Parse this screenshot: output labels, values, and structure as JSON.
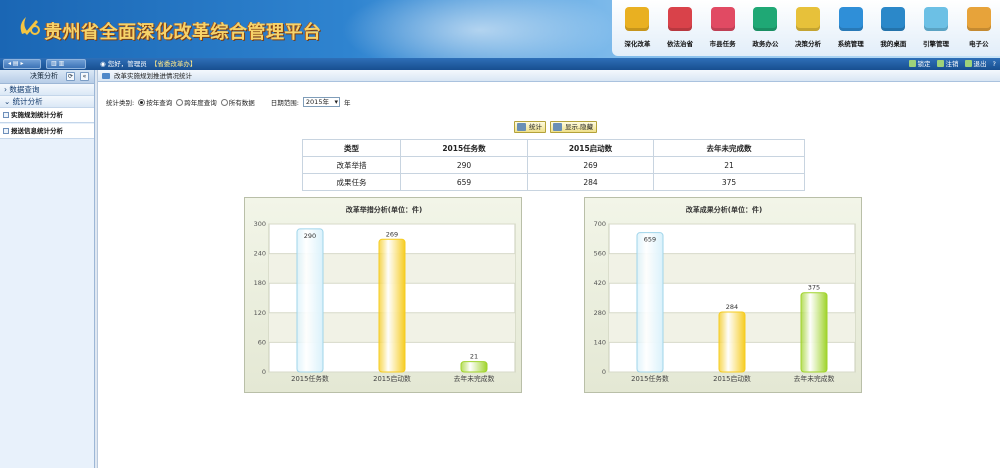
{
  "app": {
    "title": "贵州省全面深化改革综合管理平台"
  },
  "nav": [
    {
      "label": "深化改革",
      "icon": "reform-icon",
      "color": "#e9b021"
    },
    {
      "label": "依法治省",
      "icon": "law-icon",
      "color": "#d9424a"
    },
    {
      "label": "市县任务",
      "icon": "mail-icon",
      "color": "#e14a63"
    },
    {
      "label": "政务办公",
      "icon": "office-icon",
      "color": "#1fa875"
    },
    {
      "label": "决策分析",
      "icon": "analysis-icon",
      "color": "#e7c13a"
    },
    {
      "label": "系统管理",
      "icon": "tools-icon",
      "color": "#2f8fd8"
    },
    {
      "label": "我的桌面",
      "icon": "desktop-icon",
      "color": "#2b88c9"
    },
    {
      "label": "引擎管理",
      "icon": "engine-icon",
      "color": "#6cc0e5"
    },
    {
      "label": "电子公",
      "icon": "doc-icon",
      "color": "#e7a33a"
    }
  ],
  "toolbar": {
    "greeting": "您好，管理员",
    "dept": "【省委改革办】",
    "lock": "锁定",
    "logout": "注销",
    "exit": "退出",
    "help": "?"
  },
  "sidebar": {
    "title": "决策分析",
    "groups": [
      {
        "label": "数据查询"
      },
      {
        "label": "统计分析"
      }
    ],
    "items": [
      {
        "label": "实施规划统计分析"
      },
      {
        "label": "报送信息统计分析"
      }
    ]
  },
  "main": {
    "breadcrumb": "改革实施规划推进情况统计",
    "filter": {
      "type_label": "统计类别:",
      "options": [
        "按年查询",
        "跨年度查询",
        "所有数据"
      ],
      "selected": "按年查询",
      "range_label": "日期范围:",
      "year_value": "2015年",
      "year_suffix": "年"
    },
    "buttons": {
      "stats": "统计",
      "toggle": "显示.隐藏"
    },
    "table": {
      "headers": [
        "类型",
        "2015任务数",
        "2015启动数",
        "去年未完成数"
      ],
      "rows": [
        [
          "改革举措",
          "290",
          "269",
          "21"
        ],
        [
          "成果任务",
          "659",
          "284",
          "375"
        ]
      ]
    }
  },
  "chart_data": [
    {
      "type": "bar",
      "title": "改革举措分析(单位：件)",
      "categories": [
        "2015任务数",
        "2015启动数",
        "去年未完成数"
      ],
      "values": [
        290,
        269,
        21
      ],
      "colors": [
        "#d9f1fb",
        "#f6cc20",
        "#9fd32a"
      ],
      "ylim": [
        0,
        300
      ],
      "yticks": [
        0,
        60,
        120,
        180,
        240,
        300
      ],
      "grid": true
    },
    {
      "type": "bar",
      "title": "改革成果分析(单位：件)",
      "categories": [
        "2015任务数",
        "2015启动数",
        "去年未完成数"
      ],
      "values": [
        659,
        284,
        375
      ],
      "colors": [
        "#d9f1fb",
        "#f6cc20",
        "#9fd32a"
      ],
      "ylim": [
        0,
        700
      ],
      "yticks": [
        0,
        140,
        280,
        420,
        560,
        700
      ],
      "grid": true
    }
  ]
}
